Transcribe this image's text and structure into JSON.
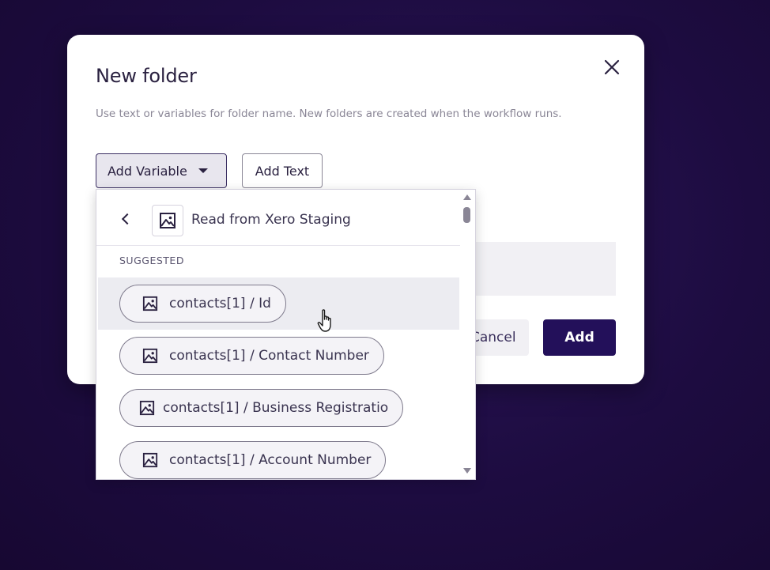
{
  "modal": {
    "title": "New folder",
    "description": "Use text or variables for folder name. New folders are created when the workflow runs.",
    "add_variable_label": "Add Variable",
    "add_text_label": "Add Text",
    "cancel_label": "Cancel",
    "add_label": "Add"
  },
  "dropdown": {
    "header_label": "Read from Xero Staging",
    "section_label": "SUGGESTED",
    "items": [
      {
        "label": "contacts[1] / Id",
        "icon": "image-icon"
      },
      {
        "label": "contacts[1] / Contact Number",
        "icon": "image-icon"
      },
      {
        "label": "contacts[1] / Business Registratio",
        "icon": "image-icon"
      },
      {
        "label": "contacts[1] / Account Number",
        "icon": "image-icon"
      }
    ]
  },
  "colors": {
    "backdrop": "#1d0c40",
    "primary": "#23105a",
    "text": "#2a2140",
    "muted": "#8a8696"
  }
}
